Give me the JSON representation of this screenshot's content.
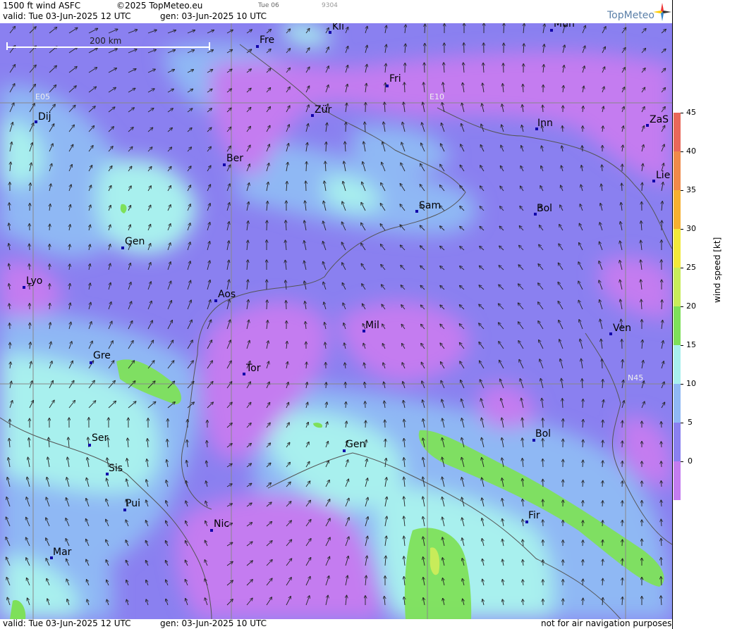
{
  "header": {
    "product": "1500 ft wind ASFC",
    "copyright": "©2025 TopMeteo.eu",
    "day_label": "Tue 06",
    "code": "9304",
    "valid": "valid:  Tue  03-Jun-2025  12 UTC",
    "gen": "gen: 03-Jun-2025 10 UTC",
    "logo": "TopMeteo"
  },
  "footer": {
    "valid": "valid:  Tue  03-Jun-2025  12 UTC",
    "gen": "gen: 03-Jun-2025 10 UTC",
    "disclaimer": "not for air navigation purposes"
  },
  "map": {
    "scale_label": "200 km",
    "grid_labels": [
      "E05",
      "E10",
      "N45"
    ],
    "cities": [
      {
        "name": "Kli"
      },
      {
        "name": "Mun"
      },
      {
        "name": "Fre"
      },
      {
        "name": "Fri"
      },
      {
        "name": "Dij"
      },
      {
        "name": "Zür"
      },
      {
        "name": "Inn"
      },
      {
        "name": "ZaS"
      },
      {
        "name": "Ber"
      },
      {
        "name": "Lie"
      },
      {
        "name": "Sam"
      },
      {
        "name": "Bol"
      },
      {
        "name": "Gen"
      },
      {
        "name": "Lyo"
      },
      {
        "name": "Aos"
      },
      {
        "name": "Mil"
      },
      {
        "name": "Ven"
      },
      {
        "name": "Gre"
      },
      {
        "name": "Tor"
      },
      {
        "name": "Ser"
      },
      {
        "name": "Gen"
      },
      {
        "name": "Bol"
      },
      {
        "name": "Sis"
      },
      {
        "name": "Pui"
      },
      {
        "name": "Nic"
      },
      {
        "name": "Fir"
      },
      {
        "name": "Mar"
      }
    ]
  },
  "colorbar": {
    "unit_label": "wind speed [kt]",
    "ticks": [
      "45",
      "40",
      "35",
      "30",
      "25",
      "20",
      "15",
      "10",
      "5",
      "0"
    ],
    "colors": [
      "#e8685a",
      "#f08a4a",
      "#f7b030",
      "#f2e83a",
      "#c8ec5a",
      "#7ee05a",
      "#a8f0ee",
      "#8fb8f4",
      "#8a80f0",
      "#c47cf0"
    ]
  }
}
